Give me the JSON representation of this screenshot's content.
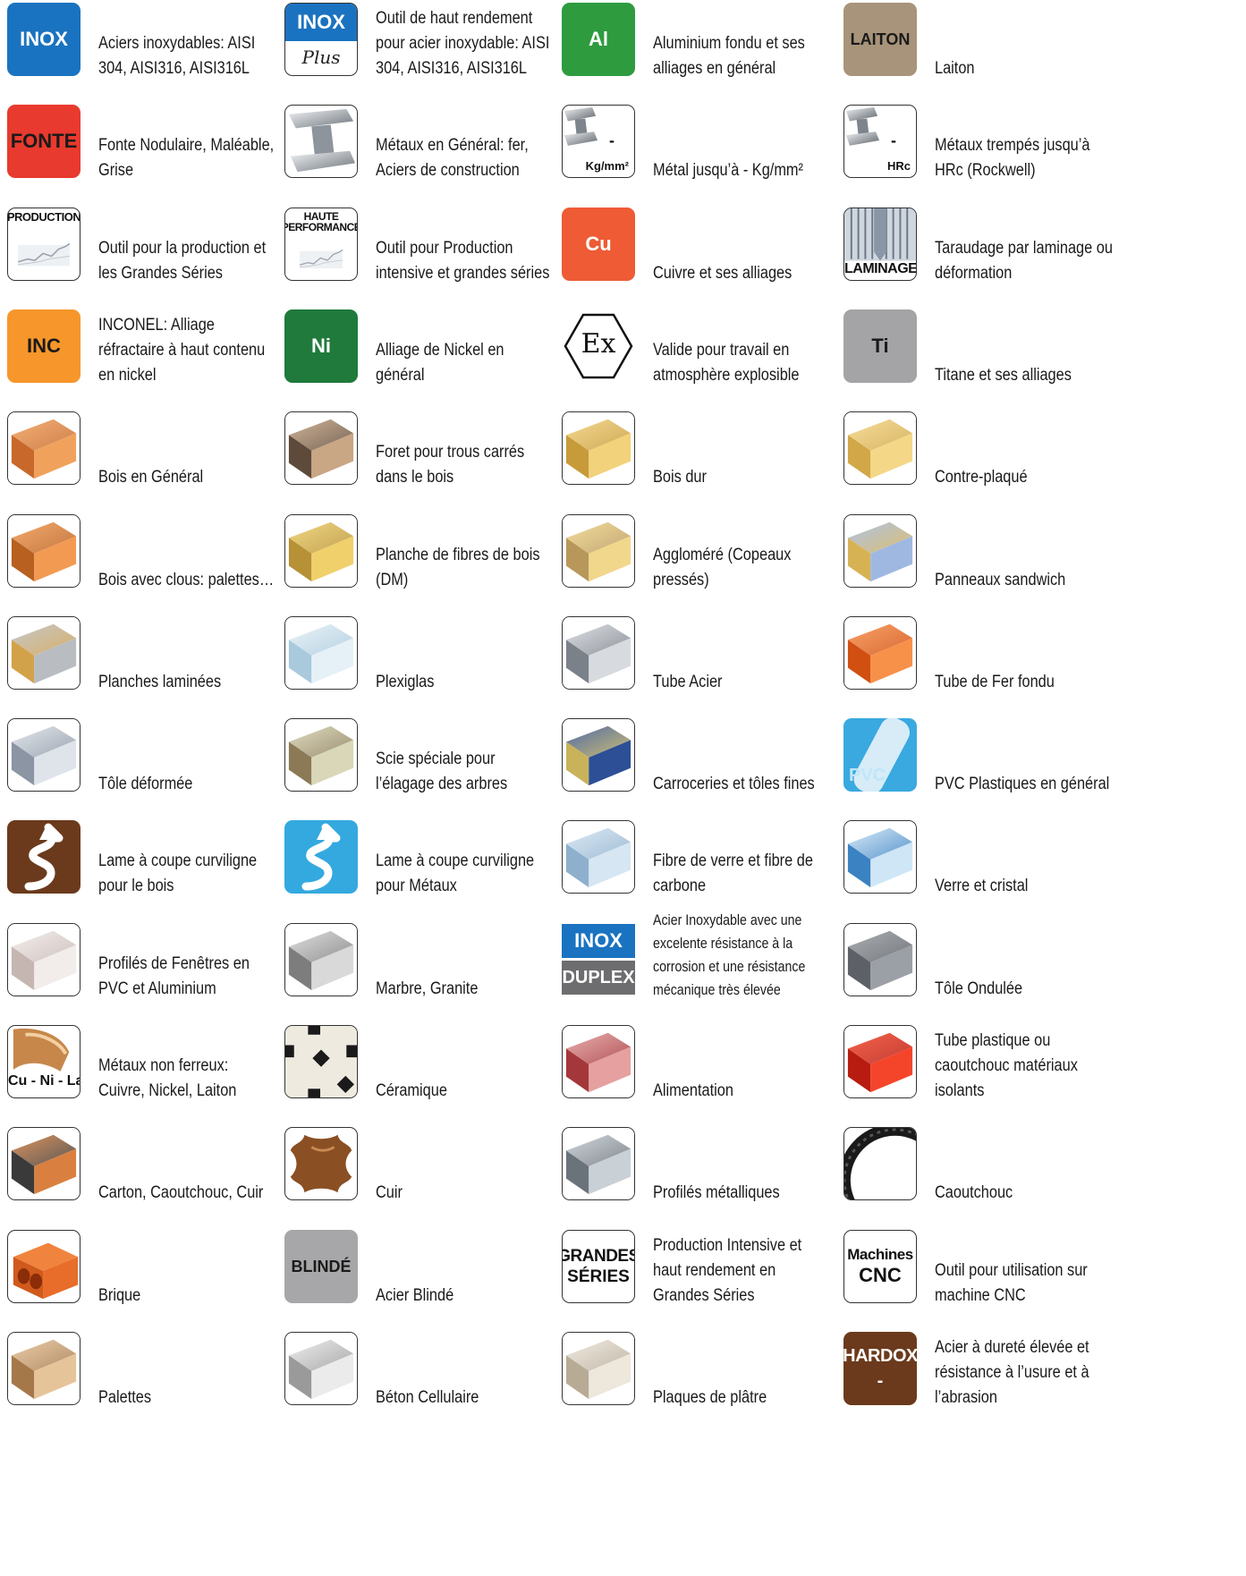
{
  "items": [
    {
      "label": "Aciers inoxydables: AISI 304, AISI316, AISI316L",
      "icon": "inox-badge-icon",
      "kind": "badge",
      "text": "INOX",
      "bg": "#1a73c0",
      "fg": "#ffffff"
    },
    {
      "label": "Outil de haut rendement pour acier inoxydable: AISI 304, AISI316, AISI316L",
      "icon": "inox-plus-badge-icon",
      "kind": "inoxplus",
      "text": "INOX",
      "sub": "Plus",
      "bg": "#1a73c0"
    },
    {
      "label": "Aluminium fondu et ses alliages en général",
      "icon": "aluminium-badge-icon",
      "kind": "badge",
      "text": "Al",
      "bg": "#2e9b3f",
      "fg": "#ffffff"
    },
    {
      "label": "Laiton",
      "icon": "laiton-badge-icon",
      "kind": "badge",
      "text": "LAITON",
      "bg": "#a8947a",
      "fg": "#1a1a1a"
    },
    {
      "label": "Fonte Nodulaire, Maléable, Grise",
      "icon": "fonte-badge-icon",
      "kind": "badge",
      "text": "FONTE",
      "bg": "#e83a2e",
      "fg": "#1a1a1a"
    },
    {
      "label": "Métaux en Général: fer, Aciers de construction",
      "icon": "steel-beam-icon",
      "kind": "beam"
    },
    {
      "label": "Métal jusqu’à - Kg/mm²",
      "icon": "metal-strength-kgmm2-icon",
      "kind": "beamtext",
      "text": "-",
      "sub": "Kg/mm²"
    },
    {
      "label": "Métaux trempés jusqu’à HRc (Rockwell)",
      "icon": "hardened-metal-hrc-icon",
      "kind": "beamtext",
      "text": "-",
      "sub": "HRc"
    },
    {
      "label": "Outil pour la production et les Grandes Séries",
      "icon": "production-chart-icon",
      "kind": "chart",
      "text": "PRODUCTION"
    },
    {
      "label": "Outil pour Production intensive et grandes séries",
      "icon": "haute-performance-chart-icon",
      "kind": "chart",
      "text": "HAUTE PERFORMANCE"
    },
    {
      "label": "Cuivre et ses alliages",
      "icon": "copper-badge-icon",
      "kind": "badge",
      "text": "Cu",
      "bg": "#ee5b34",
      "fg": "#ffffff"
    },
    {
      "label": "Taraudage par laminage ou déformation",
      "icon": "laminage-tap-icon",
      "kind": "laminage",
      "text": "LAMINAGE"
    },
    {
      "label": "INCONEL: Alliage réfractaire à haut contenu en nickel",
      "icon": "inconel-badge-icon",
      "kind": "badge",
      "text": "INC",
      "bg": "#f7962b",
      "fg": "#1a1a1a"
    },
    {
      "label": "Alliage de Nickel en général",
      "icon": "nickel-badge-icon",
      "kind": "badge",
      "text": "Ni",
      "bg": "#1f7a3c",
      "fg": "#ffffff"
    },
    {
      "label": "Valide pour travail en atmosphère explosible",
      "icon": "atex-explosive-icon",
      "kind": "ex",
      "text": "Ex"
    },
    {
      "label": "Titane et ses alliages",
      "icon": "titanium-badge-icon",
      "kind": "badge",
      "text": "Ti",
      "bg": "#a4a4a6",
      "fg": "#1a1a1a"
    },
    {
      "label": "Bois en Général",
      "icon": "wood-block-icon",
      "kind": "pic",
      "c1": "#f0a25c",
      "c2": "#c8682b"
    },
    {
      "label": "Foret pour trous carrés dans le bois",
      "icon": "square-hole-drill-icon",
      "kind": "pic",
      "c1": "#c9a684",
      "c2": "#5e4a3a"
    },
    {
      "label": "Bois dur",
      "icon": "hardwood-icon",
      "kind": "pic",
      "c1": "#f2d27a",
      "c2": "#c79a3a"
    },
    {
      "label": "Contre-plaqué",
      "icon": "plywood-icon",
      "kind": "pic",
      "c1": "#f4d888",
      "c2": "#d1a747"
    },
    {
      "label": "Bois avec clous: palettes…",
      "icon": "wood-nails-icon",
      "kind": "pic",
      "c1": "#f39a52",
      "c2": "#b8601f"
    },
    {
      "label": "Planche de fibres de bois (DM)",
      "icon": "fiberboard-icon",
      "kind": "pic",
      "c1": "#f0d06a",
      "c2": "#b69135"
    },
    {
      "label": "Aggloméré (Copeaux pressés)",
      "icon": "chipboard-icon",
      "kind": "pic",
      "c1": "#f1d78c",
      "c2": "#b8975a"
    },
    {
      "label": "Panneaux sandwich",
      "icon": "sandwich-panel-icon",
      "kind": "pic",
      "c1": "#9fb8e2",
      "c2": "#d7b255"
    },
    {
      "label": "Planches laminées",
      "icon": "laminated-board-icon",
      "kind": "pic",
      "c1": "#b9bdc2",
      "c2": "#d2a24a"
    },
    {
      "label": "Plexiglas",
      "icon": "plexiglass-tube-icon",
      "kind": "pic",
      "c1": "#e6f1f7",
      "c2": "#a9c9dc"
    },
    {
      "label": "Tube Acier",
      "icon": "steel-tube-icon",
      "kind": "pic",
      "c1": "#d7dbe0",
      "c2": "#7b8189"
    },
    {
      "label": "Tube de Fer fondu",
      "icon": "cast-iron-tube-icon",
      "kind": "pic",
      "c1": "#f7914a",
      "c2": "#d24f12"
    },
    {
      "label": "Tôle déformée",
      "icon": "bent-sheet-icon",
      "kind": "pic",
      "c1": "#dfe4ea",
      "c2": "#8b95a3"
    },
    {
      "label": "Scie spéciale pour l’élagage des arbres",
      "icon": "pruning-saw-icon",
      "kind": "pic",
      "c1": "#d9d7b8",
      "c2": "#8b7a55"
    },
    {
      "label": "Carroceries et tôles fines",
      "icon": "car-body-sheet-icon",
      "kind": "pic",
      "c1": "#2d4f96",
      "c2": "#c9b35a"
    },
    {
      "label": "PVC Plastiques en général",
      "icon": "pvc-tube-icon",
      "kind": "pvc",
      "text": "PVC",
      "bg": "#39a9e0"
    },
    {
      "label": "Lame à coupe curviligne pour le bois",
      "icon": "curved-cut-wood-icon",
      "kind": "curve",
      "bg": "#6b3a1c"
    },
    {
      "label": "Lame à coupe curviligne pour Métaux",
      "icon": "curved-cut-metal-icon",
      "kind": "curve",
      "bg": "#34a9df"
    },
    {
      "label": "Fibre de verre et fibre de carbone",
      "icon": "fiberglass-carbon-icon",
      "kind": "pic",
      "c1": "#d6e6f3",
      "c2": "#8eb0cc"
    },
    {
      "label": "Verre et cristal",
      "icon": "glass-crystal-icon",
      "kind": "pic",
      "c1": "#cfe6f7",
      "c2": "#3b82c2"
    },
    {
      "label": "Profilés de Fenêtres en PVC et Aluminium",
      "icon": "window-profile-icon",
      "kind": "pic",
      "c1": "#f2ecea",
      "c2": "#c6b6b2"
    },
    {
      "label": "Marbre, Granite",
      "icon": "marble-granite-icon",
      "kind": "pic",
      "c1": "#d9d9d9",
      "c2": "#7d7d7d"
    },
    {
      "label": "Acier Inoxydable avec une excelente résistance à la corrosion et une résistance mécanique très élevée",
      "icon": "inox-duplex-badge-icon",
      "kind": "duplex",
      "text": "INOX",
      "sub": "DUPLEX",
      "small": true
    },
    {
      "label": "Tôle Ondulée",
      "icon": "corrugated-sheet-icon",
      "kind": "pic",
      "c1": "#9ba0a6",
      "c2": "#5d6167"
    },
    {
      "label": "Métaux non ferreux: Cuivre, Nickel, Laiton",
      "icon": "non-ferrous-metals-icon",
      "kind": "cunila",
      "text": "Cu - Ni - La"
    },
    {
      "label": "Céramique",
      "icon": "ceramic-tiles-icon",
      "kind": "tiles"
    },
    {
      "label": "Alimentation",
      "icon": "food-meat-icon",
      "kind": "pic",
      "c1": "#e6a0a0",
      "c2": "#a4373a"
    },
    {
      "label": "Tube plastique ou caoutchouc matériaux isolants",
      "icon": "plastic-rubber-tube-icon",
      "kind": "pic",
      "c1": "#f4452a",
      "c2": "#b81c10"
    },
    {
      "label": "Carton, Caoutchouc, Cuir",
      "icon": "cardboard-rubber-leather-icon",
      "kind": "pic",
      "c1": "#d98040",
      "c2": "#3a3a3a"
    },
    {
      "label": "Cuir",
      "icon": "leather-hide-icon",
      "kind": "hide"
    },
    {
      "label": "Profilés métalliques",
      "icon": "metal-profiles-icon",
      "kind": "pic",
      "c1": "#c9d0d6",
      "c2": "#6b737a"
    },
    {
      "label": "Caoutchouc",
      "icon": "rubber-tire-icon",
      "kind": "tire"
    },
    {
      "label": "Brique",
      "icon": "brick-icon",
      "kind": "brick"
    },
    {
      "label": "Acier Blindé",
      "icon": "blinde-badge-icon",
      "kind": "badge",
      "text": "BLINDÉ",
      "bg": "#a7a7a9",
      "fg": "#1a1a1a"
    },
    {
      "label": "Production Intensive et haut rendement en Grandes Séries",
      "icon": "grandes-series-badge-icon",
      "kind": "textbox",
      "text": "GRANDES",
      "sub": "SÉRIES"
    },
    {
      "label": "Outil pour utilisation sur machine CNC",
      "icon": "cnc-machines-badge-icon",
      "kind": "textbox",
      "text": "Machines",
      "sub": "CNC"
    },
    {
      "label": "Palettes",
      "icon": "pallet-icon",
      "kind": "pic",
      "c1": "#e6c49a",
      "c2": "#a5784a"
    },
    {
      "label": "Béton Cellulaire",
      "icon": "cellular-concrete-icon",
      "kind": "pic",
      "c1": "#ebebeb",
      "c2": "#9a9a9a"
    },
    {
      "label": "Plaques de plâtre",
      "icon": "plasterboard-icon",
      "kind": "pic",
      "c1": "#ede7dc",
      "c2": "#b7ab96"
    },
    {
      "label": "Acier à dureté élevée et résistance à l’usure et à l’abrasion",
      "icon": "hardox-badge-icon",
      "kind": "hardox",
      "text": "HARDOX",
      "sub": "-",
      "bg": "#6b3a1c"
    }
  ]
}
